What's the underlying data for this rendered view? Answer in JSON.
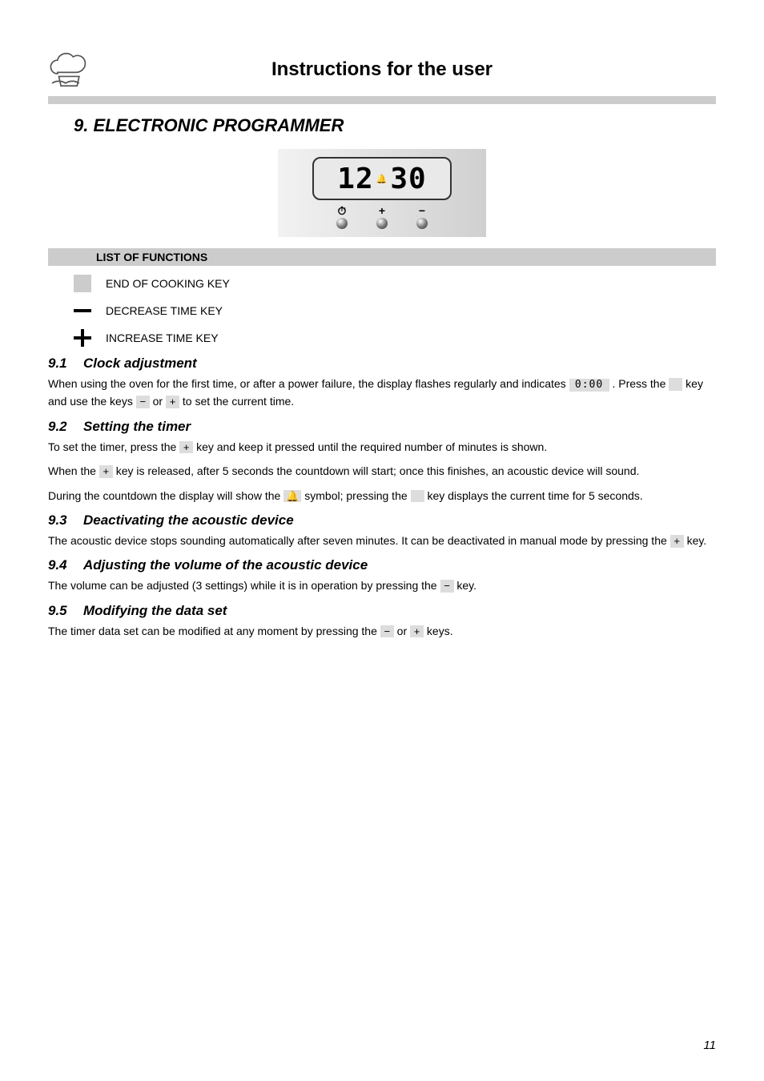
{
  "header": {
    "title": "Instructions for the user"
  },
  "chapter": {
    "num": "9.",
    "title": "ELECTRONIC PROGRAMMER"
  },
  "panel": {
    "display_left": "12",
    "display_right": "30",
    "btn_timer_sym": "⏱",
    "btn_plus_sym": "+",
    "btn_minus_sym": "−"
  },
  "functions": {
    "heading": "LIST OF FUNCTIONS",
    "end_key": "END OF COOKING KEY",
    "dec_key": "DECREASE TIME KEY",
    "inc_key": "INCREASE TIME KEY"
  },
  "s91": {
    "num": "9.1",
    "title": "Clock adjustment",
    "p1a": "When using the oven for the first time, or after a power failure, the display flashes regularly and indicates ",
    "key_time": "0:00",
    "p1b": " . Press the ",
    "p1c": " key and use the keys ",
    "key_minus": "−",
    "p1d": " or ",
    "key_plus": "+",
    "p1e": " to set the current time."
  },
  "s92": {
    "num": "9.2",
    "title": "Setting the timer",
    "p1a": "To set the timer, press the ",
    "key_plus1": "+",
    "p1b": " key and keep it pressed until the required number of minutes is shown.",
    "p2a": "When the ",
    "key_plus2": "+",
    "p2b": " key is released, after 5 seconds the countdown will start; once this finishes, an acoustic device will sound.",
    "p3a": "During the countdown the display will show the ",
    "key_bell": "🔔",
    "p3b": " symbol; pressing the ",
    "p3c": " key displays the current time for 5 seconds."
  },
  "s93": {
    "num": "9.3",
    "title": "Deactivating the acoustic device",
    "p1a": "The acoustic device stops sounding automatically after seven minutes. It can be deactivated in manual mode by pressing the ",
    "key_plus": "+",
    "p1b": " key."
  },
  "s94": {
    "num": "9.4",
    "title": "Adjusting the volume of the acoustic device",
    "p1a": "The volume can be adjusted (3 settings) while it is in operation by pressing the ",
    "key_minus": "−",
    "p1b": " key."
  },
  "s95": {
    "num": "9.5",
    "title": "Modifying the data set",
    "p1a": "The timer data set can be modified at any moment by pressing the ",
    "key_minus": "−",
    "p1b": " or ",
    "key_plus": "+",
    "p1c": " keys."
  },
  "page_number": "11"
}
